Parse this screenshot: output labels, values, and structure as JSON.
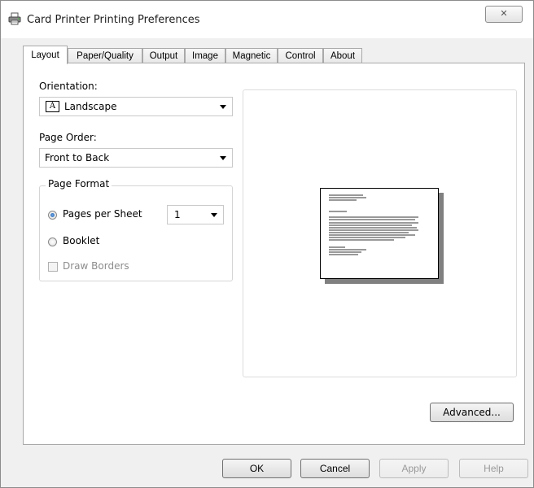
{
  "window": {
    "title": "Card Printer Printing Preferences",
    "close_glyph": "✕"
  },
  "tabs": [
    {
      "label": "Layout",
      "active": true
    },
    {
      "label": "Paper/Quality",
      "active": false
    },
    {
      "label": "Output",
      "active": false
    },
    {
      "label": "Image",
      "active": false
    },
    {
      "label": "Magnetic",
      "active": false
    },
    {
      "label": "Control",
      "active": false
    },
    {
      "label": "About",
      "active": false
    }
  ],
  "layout": {
    "orientation_label": "Orientation:",
    "orientation_value": "Landscape",
    "orientation_icon_glyph": "A",
    "page_order_label": "Page Order:",
    "page_order_value": "Front to Back",
    "page_format": {
      "title": "Page Format",
      "pages_per_sheet_label": "Pages per Sheet",
      "pages_per_sheet_value": "1",
      "pages_per_sheet_checked": true,
      "booklet_label": "Booklet",
      "booklet_checked": false,
      "draw_borders_label": "Draw Borders",
      "draw_borders_checked": false,
      "draw_borders_enabled": false
    },
    "advanced_button": "Advanced..."
  },
  "footer": {
    "ok": "OK",
    "cancel": "Cancel",
    "apply": "Apply",
    "help": "Help"
  },
  "colors": {
    "dialog_bg": "#f0f0f0",
    "panel_bg": "#ffffff",
    "radio_selected": "#1f5ca8",
    "disabled_text": "#8d8d8d"
  }
}
